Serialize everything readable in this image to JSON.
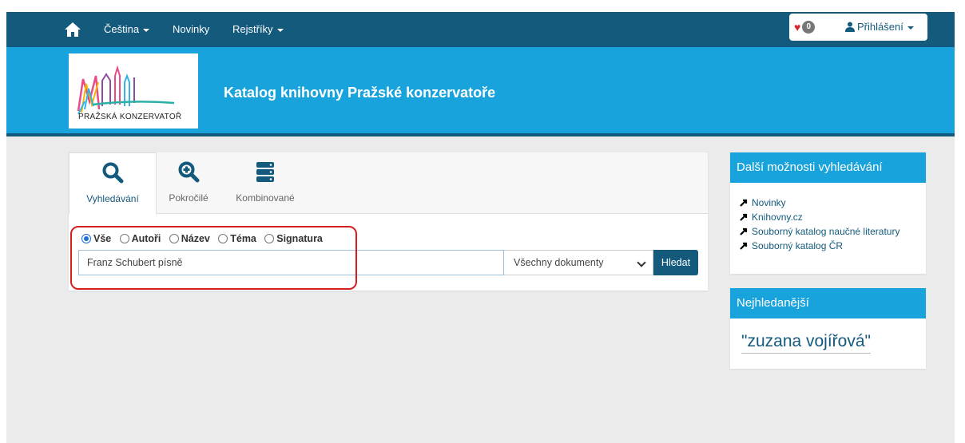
{
  "navbar": {
    "language": "Čeština",
    "news": "Novinky",
    "registers": "Rejstříky",
    "favorites_count": "0",
    "login": "Přihlášení"
  },
  "banner": {
    "logo_text": "PRAŽSKÁ KONZERVATOŘ",
    "title": "Katalog knihovny Pražské konzervatoře"
  },
  "search": {
    "tabs": [
      {
        "label": "Vyhledávání",
        "icon": "search-icon"
      },
      {
        "label": "Pokročilé",
        "icon": "zoom-in-icon"
      },
      {
        "label": "Kombinované",
        "icon": "server-icon"
      }
    ],
    "radio_options": [
      {
        "label": "Vše",
        "checked": true
      },
      {
        "label": "Autoři",
        "checked": false
      },
      {
        "label": "Název",
        "checked": false
      },
      {
        "label": "Téma",
        "checked": false
      },
      {
        "label": "Signatura",
        "checked": false
      }
    ],
    "query": "Franz Schubert písně",
    "doc_type": "Všechny dokumenty",
    "button": "Hledat"
  },
  "sidebar": {
    "more_title": "Další možnosti vyhledávání",
    "links": [
      "Novinky",
      "Knihovny.cz",
      "Souborný katalog naučné literatury",
      "Souborný katalog ČR"
    ],
    "popular_title": "Nejhledanější",
    "popular_query": "\"zuzana vojířová\""
  },
  "colors": {
    "navbar": "#135a7c",
    "banner": "#19a3dd",
    "annotation": "#d21f1f"
  }
}
